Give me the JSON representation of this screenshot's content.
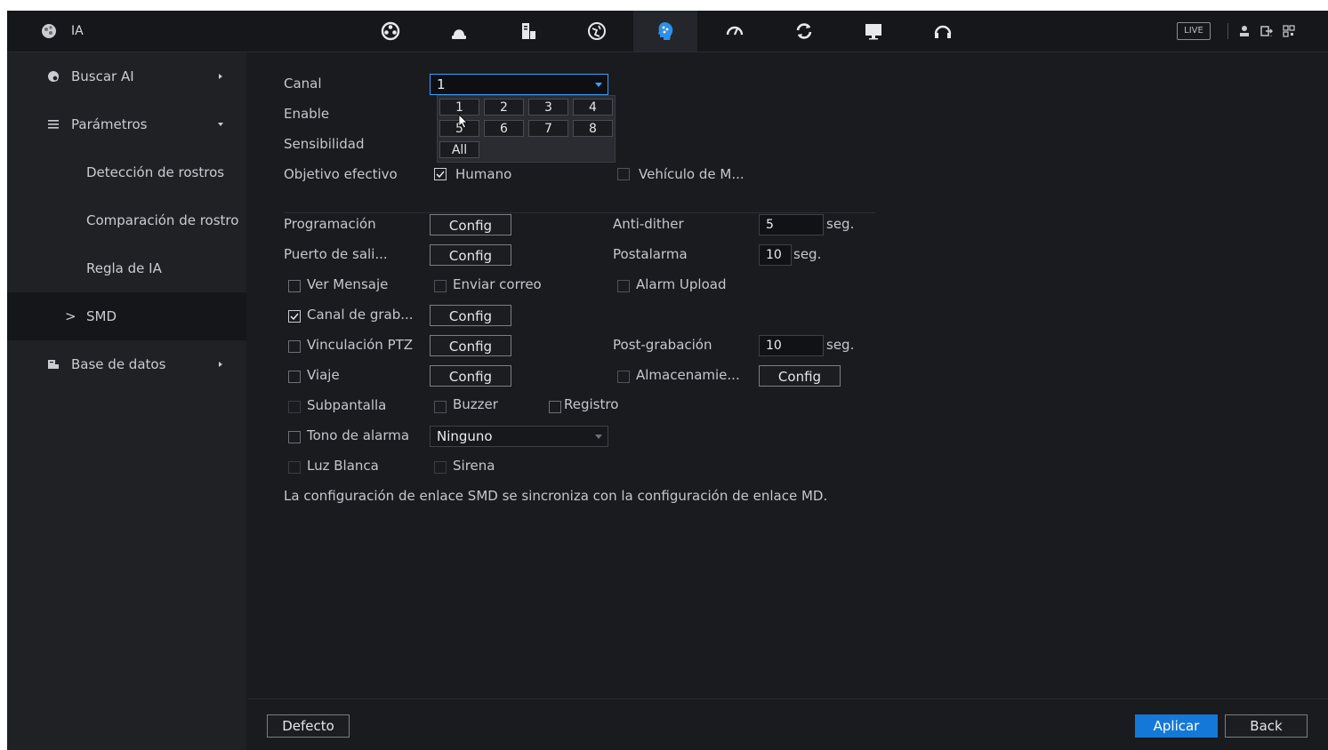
{
  "app": {
    "title": "IA",
    "live_label": "LIVE"
  },
  "topbar": {
    "tabs": [
      {
        "icon": "camera-ptz-icon"
      },
      {
        "icon": "alarm-light-icon"
      },
      {
        "icon": "storage-device-icon"
      },
      {
        "icon": "network-globe-icon"
      },
      {
        "icon": "ai-head-icon",
        "active": true
      },
      {
        "icon": "speedometer-icon"
      },
      {
        "icon": "refresh-sync-icon"
      },
      {
        "icon": "monitor-display-icon"
      },
      {
        "icon": "headset-support-icon"
      }
    ]
  },
  "sidebar": {
    "items": [
      {
        "label": "Buscar AI",
        "icon": "search-ai-icon",
        "arrow": "right"
      },
      {
        "label": "Parámetros",
        "icon": "list-icon",
        "arrow": "down"
      },
      {
        "label": "Detección de rostros"
      },
      {
        "label": "Comparación de rostro"
      },
      {
        "label": "Regla de IA"
      },
      {
        "label": "SMD",
        "active": true,
        "prefix": ">"
      },
      {
        "label": "Base de datos",
        "icon": "database-icon",
        "arrow": "right"
      }
    ]
  },
  "form": {
    "canal_label": "Canal",
    "canal_value": "1",
    "enable_label": "Enable",
    "sensibilidad_label": "Sensibilidad",
    "objetivo_label": "Objetivo efectivo",
    "humano_label": "Humano",
    "vehiculo_label": "Vehículo de M...",
    "dropdown_options": [
      "1",
      "2",
      "3",
      "4",
      "5",
      "6",
      "7",
      "8"
    ],
    "dropdown_all": "All",
    "programacion_label": "Programación",
    "puerto_label": "Puerto de sali...",
    "ver_mensaje_label": "Ver Mensaje",
    "enviar_correo_label": "Enviar correo",
    "alarm_upload_label": "Alarm Upload",
    "canal_grab_label": "Canal de grab...",
    "vinculacion_label": "Vinculación PTZ",
    "viaje_label": "Viaje",
    "almacenamiento_label": "Almacenamie...",
    "subpantalla_label": "Subpantalla",
    "buzzer_label": "Buzzer",
    "registro_label": "Registro",
    "tono_label": "Tono de alarma",
    "tono_value": "Ninguno",
    "luz_label": "Luz Blanca",
    "sirena_label": "Sirena",
    "config_label": "Config",
    "anti_dither_label": "Anti-dither",
    "anti_dither_value": "5",
    "postalarma_label": "Postalarma",
    "postalarma_value": "10",
    "postgrab_label": "Post-grabación",
    "postgrab_value": "10",
    "seg_label": "seg.",
    "note": "La configuración de enlace SMD se sincroniza con la configuración de enlace MD."
  },
  "footer": {
    "defecto_label": "Defecto",
    "aplicar_label": "Aplicar",
    "back_label": "Back"
  },
  "colors": {
    "accent": "#1478d8",
    "focus": "#3aa0ff",
    "background": "#1a1b1f",
    "sidebar": "#202125"
  }
}
